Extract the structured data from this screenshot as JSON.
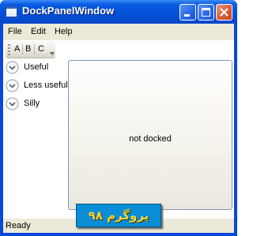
{
  "window": {
    "title": "DockPanelWindow"
  },
  "menu": {
    "items": [
      {
        "label": "File"
      },
      {
        "label": "Edit"
      },
      {
        "label": "Help"
      }
    ]
  },
  "toolbar": {
    "buttons": [
      {
        "label": "A"
      },
      {
        "label": "B"
      },
      {
        "label": "C"
      }
    ]
  },
  "list": {
    "items": [
      {
        "label": "Useful"
      },
      {
        "label": "Less useful"
      },
      {
        "label": "Silly"
      }
    ]
  },
  "content": {
    "text": "not docked"
  },
  "status": {
    "text": "Ready"
  },
  "watermark": {
    "text": "پروگرم ۹۸"
  },
  "colors": {
    "titlebar": "#0a5ce3",
    "chrome": "#ece9d8",
    "panel_border": "#7d98b8",
    "watermark_bg": "#0a8ed6",
    "watermark_text": "#f3d43c",
    "close_button": "#d65f3b"
  }
}
